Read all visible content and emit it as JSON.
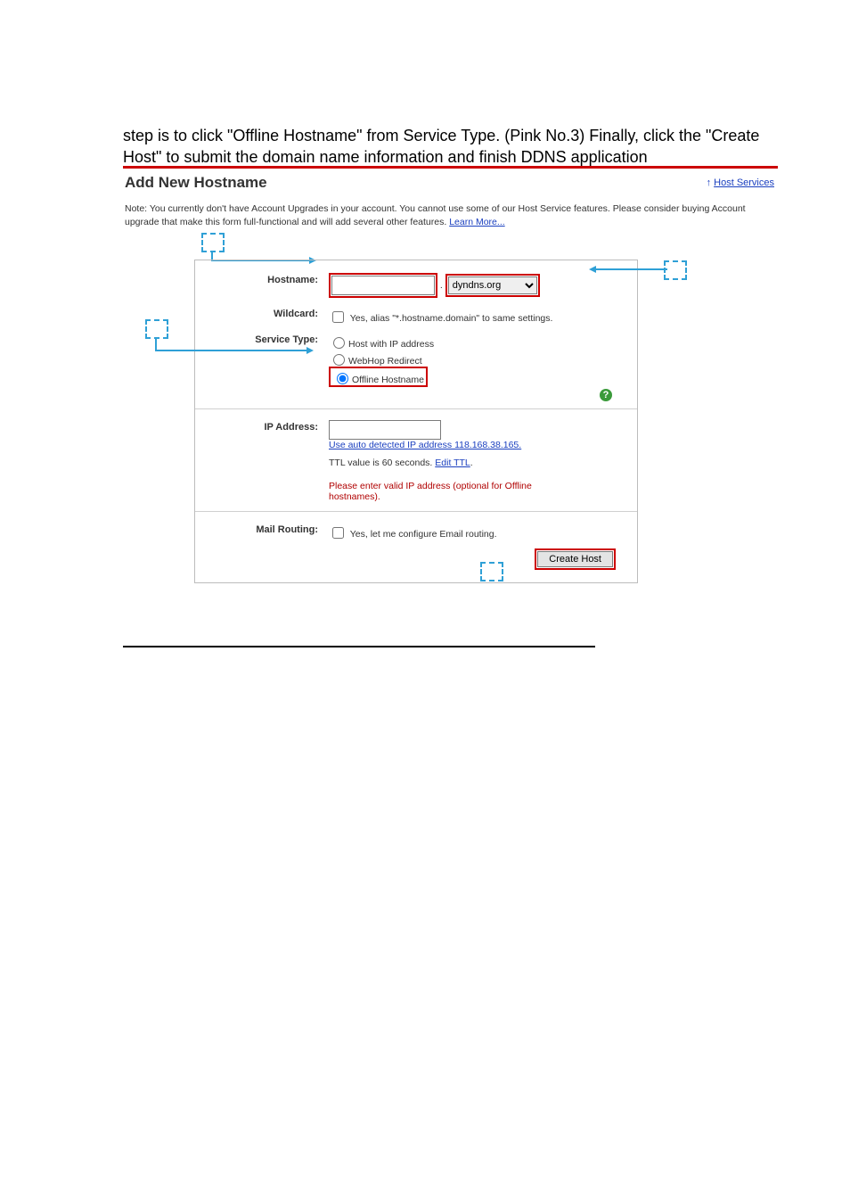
{
  "intro": "step is to click \"Offline Hostname\" from Service Type. (Pink No.3) Finally, click the \"Create Host\" to submit the domain name information and finish DDNS application",
  "panel": {
    "title": "Add New Hostname",
    "back_link_arrow": "↑",
    "back_link": "Host Services",
    "note_part1": "Note: You currently don't have Account Upgrades in your account. You cannot use some of our Host Service features. Please consider buying Account upgrade that make this form full-functional and will add several other features. ",
    "note_link": "Learn More..."
  },
  "form": {
    "hostname_label": "Hostname:",
    "hostname_value": "",
    "domain_select_value": "dyndns.org",
    "wildcard_label": "Wildcard:",
    "wildcard_option": "Yes, alias \"*.hostname.domain\" to same settings.",
    "service_type_label": "Service Type:",
    "service_options": {
      "ip": "Host with IP address",
      "webhop": "WebHop Redirect",
      "offline": "Offline Hostname"
    },
    "help_icon": "?",
    "ip_label": "IP Address:",
    "ip_value": "",
    "ip_autodetect_link": "Use auto detected IP address 118.168.38.165.",
    "ttl_text_part1": "TTL value is 60 seconds. ",
    "ttl_link": "Edit TTL",
    "ttl_text_part2": ".",
    "ip_warning": "Please enter valid IP address (optional for Offline hostnames).",
    "mail_label": "Mail Routing:",
    "mail_option": "Yes, let me configure Email routing.",
    "submit": "Create Host"
  }
}
